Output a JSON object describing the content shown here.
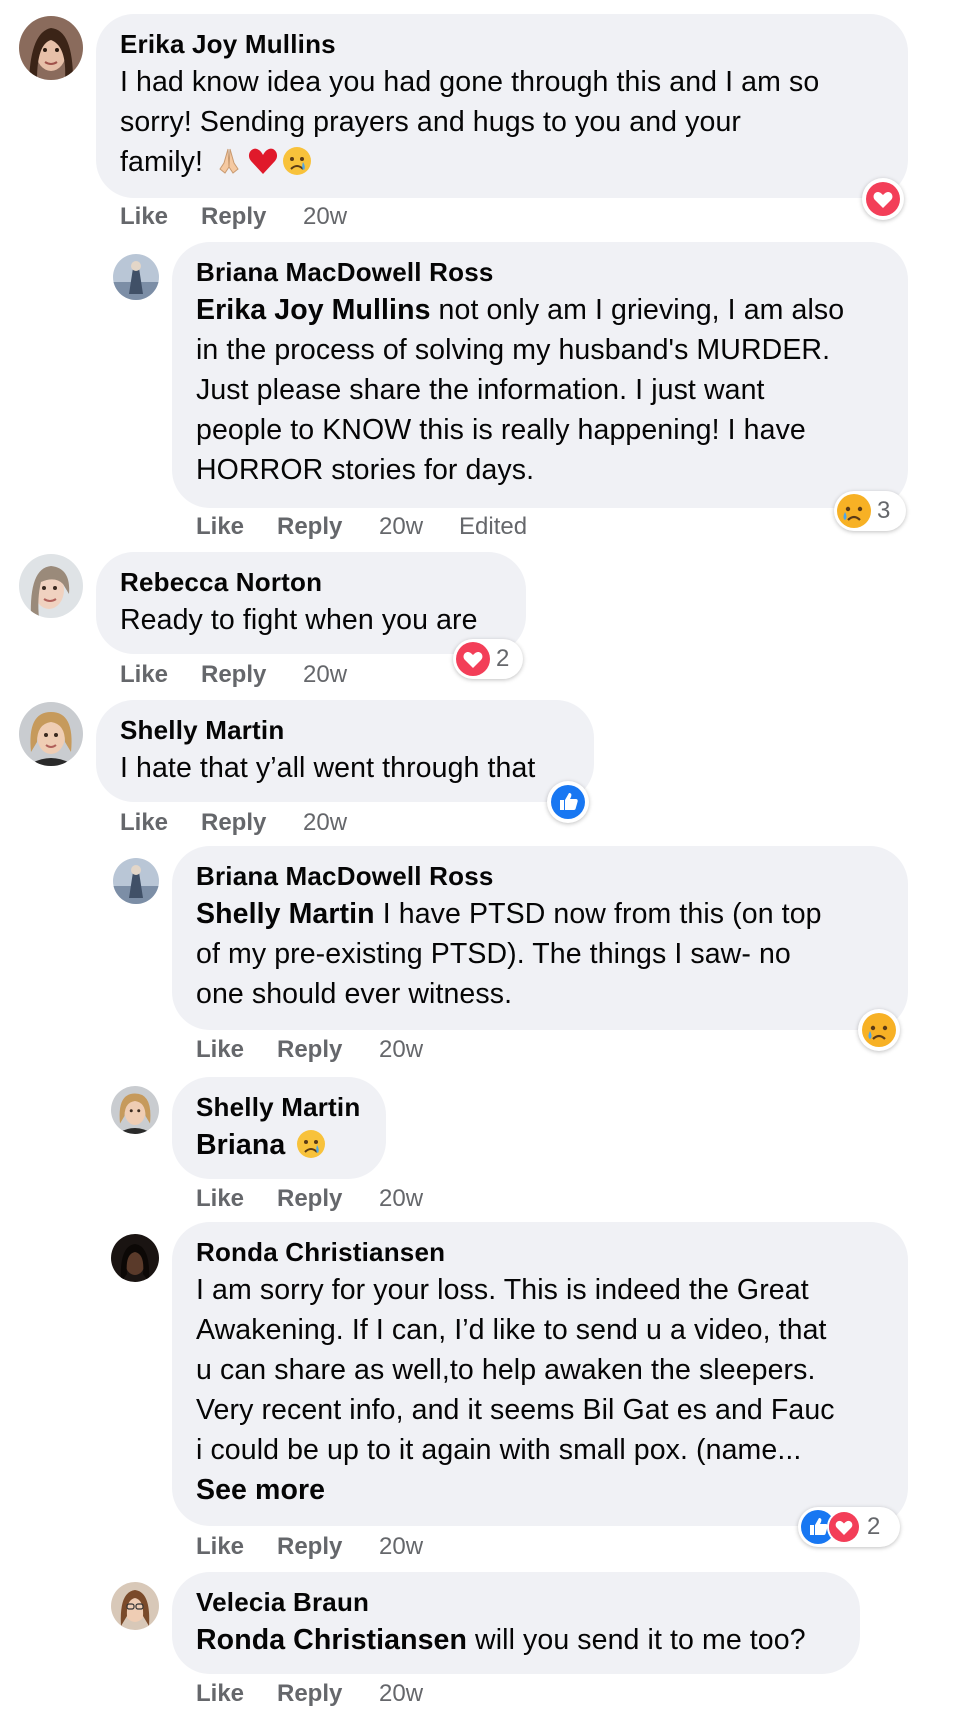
{
  "actions": {
    "like": "Like",
    "reply": "Reply"
  },
  "comments": [
    {
      "author": "Erika Joy Mullins",
      "lines": [
        "I had know idea you had gone through this and I am so",
        "sorry! Sending prayers and hugs to you and your",
        "family!"
      ],
      "emojis": [
        "folded-hands-emoji",
        "red-heart-emoji",
        "crying-face-emoji"
      ],
      "time": "20w",
      "reactions": {
        "types": [
          "love"
        ],
        "count": ""
      }
    },
    {
      "author": "Briana MacDowell Ross",
      "mention": "Erika Joy Mullins",
      "lines": [
        " not only am I grieving, I am also",
        "in the process of solving my husband's MURDER.",
        "Just please share the information. I just want",
        "people to KNOW this is really happening! I have",
        "HORROR stories for days."
      ],
      "time": "20w",
      "edited": "Edited",
      "reactions": {
        "types": [
          "sad"
        ],
        "count": "3"
      }
    },
    {
      "author": "Rebecca Norton",
      "lines": [
        "Ready to fight when you are"
      ],
      "time": "20w",
      "reactions": {
        "types": [
          "love"
        ],
        "count": "2"
      }
    },
    {
      "author": "Shelly Martin",
      "lines": [
        "I hate that y’all went through that"
      ],
      "time": "20w",
      "reactions": {
        "types": [
          "like"
        ],
        "count": ""
      }
    },
    {
      "author": "Briana MacDowell Ross",
      "mention": "Shelly Martin",
      "lines": [
        " I have PTSD now from this (on top",
        "of my pre-existing PTSD). The things I saw- no",
        "one should ever witness."
      ],
      "time": "20w",
      "reactions": {
        "types": [
          "sad"
        ],
        "count": ""
      }
    },
    {
      "author": "Shelly Martin",
      "mention": "Briana",
      "lines": [
        " "
      ],
      "emojis": [
        "crying-face-emoji"
      ],
      "time": "20w"
    },
    {
      "author": "Ronda Christiansen",
      "lines": [
        "I am sorry for your loss. This is indeed the Great",
        "Awakening. If I can, I’d like to send u a video, that",
        "u can share as well,to help awaken the sleepers.",
        "Very recent info, and it seems Bil Gat es and Fauc",
        "i could be up to it again with small pox. (name..."
      ],
      "see_more": "See more",
      "time": "20w",
      "reactions": {
        "types": [
          "like",
          "love"
        ],
        "count": "2"
      }
    },
    {
      "author": "Velecia Braun",
      "mention": "Ronda Christiansen",
      "lines": [
        " will you send it to me too?"
      ],
      "time": "20w"
    }
  ],
  "colors": {
    "bubble": "#f0f1f5",
    "meta_text": "#65676b",
    "love": "#f33e58",
    "like": "#1877f2",
    "sad": "#f7b125"
  }
}
